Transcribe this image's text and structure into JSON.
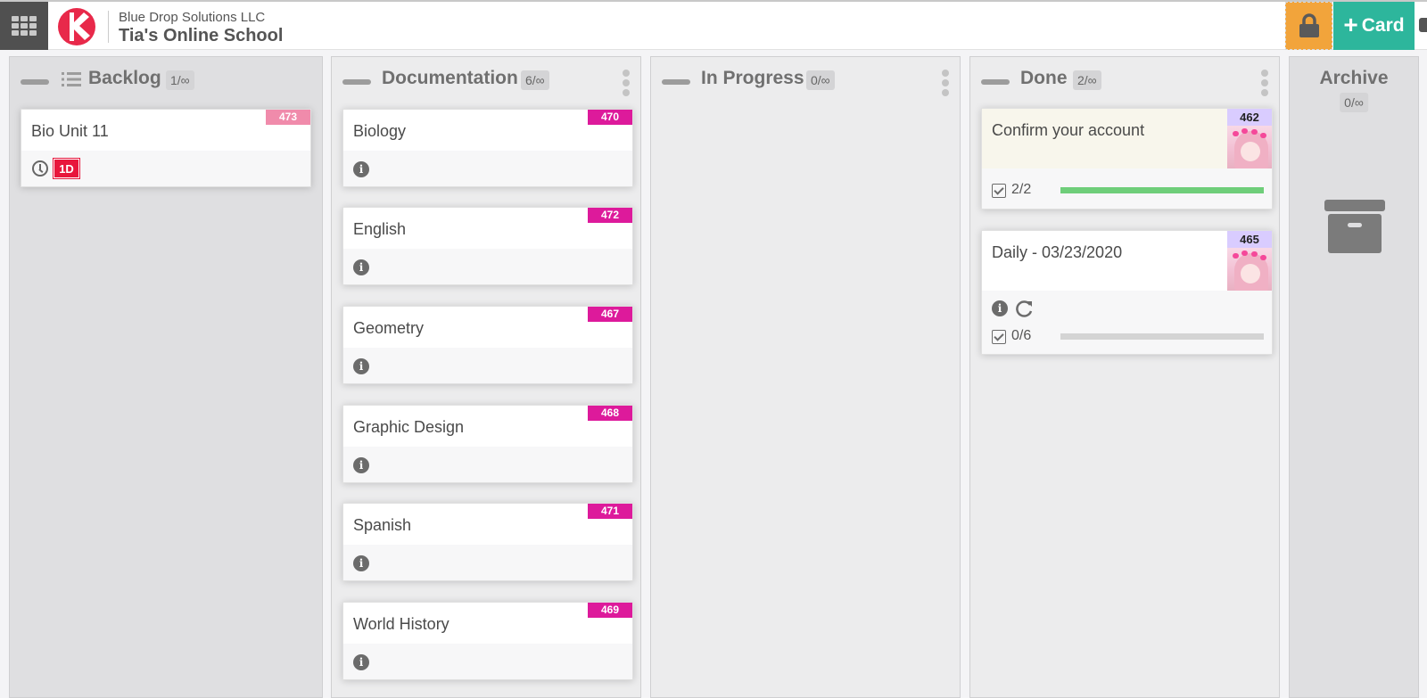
{
  "header": {
    "org_name": "Blue Drop Solutions LLC",
    "board_name": "Tia's Online School",
    "add_card_label": "Card",
    "colors": {
      "lock": "#f2a43b",
      "add_card": "#2db69c",
      "logo": "#e8294a"
    }
  },
  "columns": [
    {
      "title": "Backlog",
      "wip": "1/∞",
      "cards": [
        {
          "number": "473",
          "title": "Bio Unit 11",
          "tag_color": "#f08bab",
          "due_badge": "1D",
          "footer_icons": [
            "clock-icon"
          ]
        }
      ]
    },
    {
      "title": "Documentation",
      "wip": "6/∞",
      "cards": [
        {
          "number": "470",
          "title": "Biology",
          "tag_color": "#dd1a9b",
          "footer_icons": [
            "info-icon"
          ]
        },
        {
          "number": "472",
          "title": "English",
          "tag_color": "#dd1a9b",
          "footer_icons": [
            "info-icon"
          ]
        },
        {
          "number": "467",
          "title": "Geometry",
          "tag_color": "#dd1a9b",
          "footer_icons": [
            "info-icon"
          ]
        },
        {
          "number": "468",
          "title": "Graphic Design",
          "tag_color": "#dd1a9b",
          "footer_icons": [
            "info-icon"
          ]
        },
        {
          "number": "471",
          "title": "Spanish",
          "tag_color": "#dd1a9b",
          "footer_icons": [
            "info-icon"
          ]
        },
        {
          "number": "469",
          "title": "World History",
          "tag_color": "#dd1a9b",
          "footer_icons": [
            "info-icon"
          ]
        }
      ]
    },
    {
      "title": "In Progress",
      "wip": "0/∞",
      "cards": []
    },
    {
      "title": "Done",
      "wip": "2/∞",
      "cards": [
        {
          "number": "462",
          "title": "Confirm your account",
          "tag_color": "#d9ccff",
          "checklist": "2/2",
          "progress": 1.0,
          "footer_icons": []
        },
        {
          "number": "465",
          "title": "Daily - 03/23/2020",
          "tag_color": "#d9ccff",
          "checklist": "0/6",
          "progress": 0.0,
          "footer_icons": [
            "info-icon",
            "recurring-icon"
          ]
        }
      ]
    }
  ],
  "archive": {
    "title": "Archive",
    "wip": "0/∞"
  }
}
